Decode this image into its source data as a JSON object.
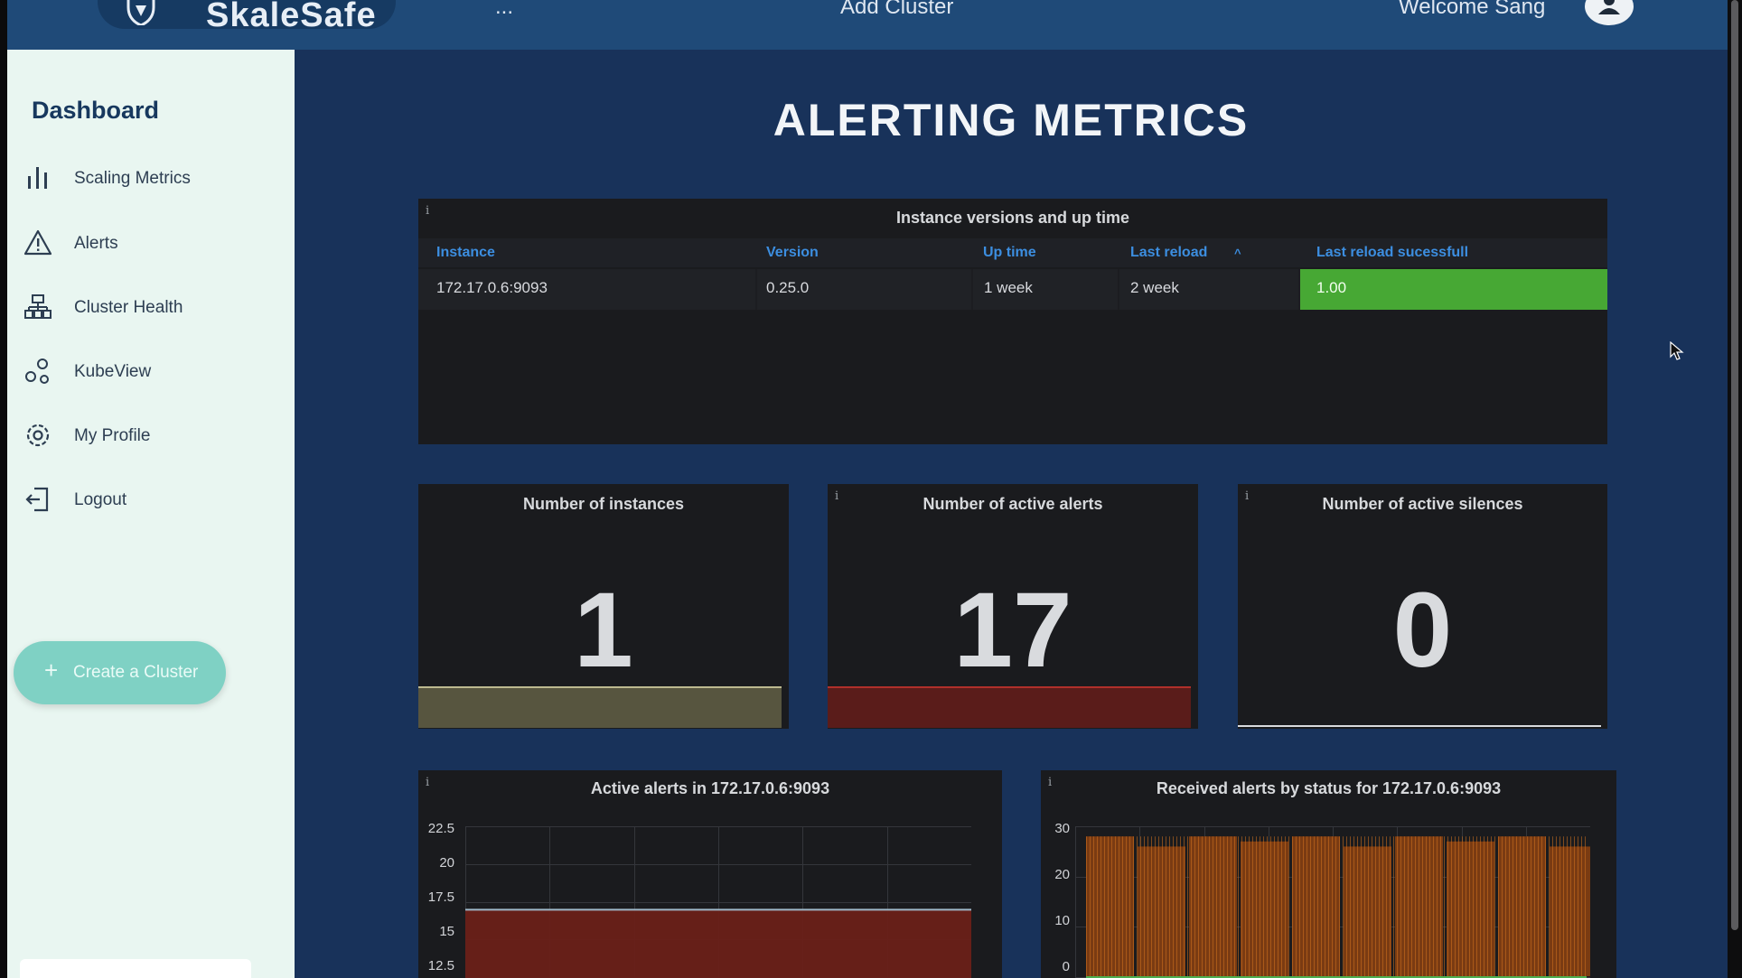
{
  "app": {
    "brand": "SkaleSafe",
    "nav": {
      "partial_item": "...",
      "add_cluster": "Add Cluster"
    },
    "welcome": "Welcome Sang"
  },
  "sidebar": {
    "title": "Dashboard",
    "items": [
      {
        "label": "Scaling Metrics",
        "icon": "bar-chart-icon"
      },
      {
        "label": "Alerts",
        "icon": "warning-triangle-icon"
      },
      {
        "label": "Cluster Health",
        "icon": "network-tree-icon"
      },
      {
        "label": "KubeView",
        "icon": "nodes-icon"
      },
      {
        "label": "My Profile",
        "icon": "gear-icon"
      },
      {
        "label": "Logout",
        "icon": "logout-icon"
      }
    ],
    "create_button": "Create a Cluster"
  },
  "main": {
    "title": "ALERTING METRICS",
    "instance_table": {
      "title": "Instance versions and up time",
      "columns": [
        "Instance",
        "Version",
        "Up time",
        "Last reload",
        "Last reload sucessfull"
      ],
      "sort_indicator": "^",
      "rows": [
        {
          "instance": "172.17.0.6:9093",
          "version": "0.25.0",
          "uptime": "1 week",
          "last_reload": "2 week",
          "last_reload_ok": "1.00"
        }
      ]
    },
    "stats": [
      {
        "title": "Number of instances",
        "value": "1",
        "bar_color": "#57553f"
      },
      {
        "title": "Number of active alerts",
        "value": "17",
        "bar_color": "#5a1c1a"
      },
      {
        "title": "Number of active silences",
        "value": "0",
        "bar_color": "#d8dade"
      }
    ],
    "charts": [
      {
        "title": "Active alerts in 172.17.0.6:9093",
        "y_ticks": [
          "22.5",
          "20",
          "17.5",
          "15",
          "12.5"
        ]
      },
      {
        "title": "Received alerts by status for 172.17.0.6:9093",
        "y_ticks": [
          "30",
          "20",
          "10",
          "0"
        ]
      }
    ]
  },
  "chart_data": [
    {
      "type": "area",
      "title": "Active alerts in 172.17.0.6:9093",
      "ylim": [
        12.5,
        22.5
      ],
      "grid": true,
      "series": [
        {
          "values": [
            17,
            17,
            17,
            17,
            17,
            17,
            17
          ]
        }
      ],
      "color": "#c0392b"
    },
    {
      "type": "bar",
      "title": "Received alerts by status for 172.17.0.6:9093",
      "ylim": [
        0,
        30
      ],
      "grid": true,
      "series": [
        {
          "values": [
            28,
            26,
            28,
            27,
            28,
            26,
            28,
            27,
            28,
            26
          ]
        }
      ],
      "color": "#e67e22"
    }
  ]
}
